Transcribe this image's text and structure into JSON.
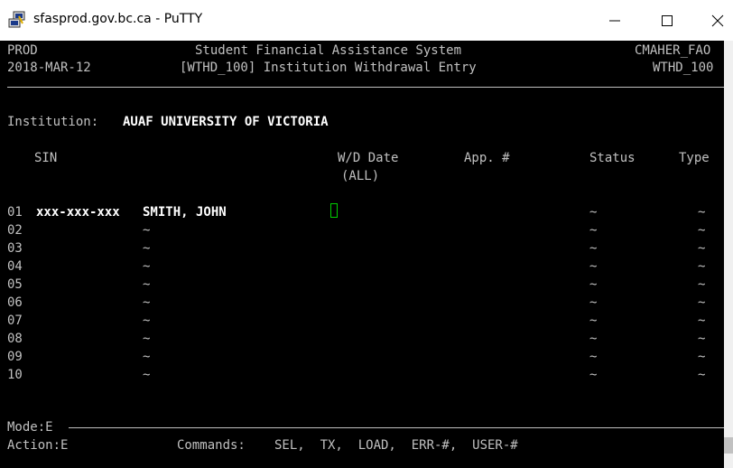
{
  "window": {
    "title": "sfasprod.gov.bc.ca - PuTTY"
  },
  "header": {
    "env": "PROD",
    "system_title": "Student Financial Assistance System",
    "user": "CMAHER_FAO",
    "date": "2018-MAR-12",
    "screen_title": "[WTHD_100] Institution Withdrawal Entry",
    "screen_code": "WTHD_100"
  },
  "institution": {
    "label": "Institution:",
    "value": "AUAF UNIVERSITY OF VICTORIA"
  },
  "columns": {
    "sin": "SIN",
    "wd_date": "W/D Date",
    "wd_date_sub": "(ALL)",
    "app": "App. #",
    "status": "Status",
    "type": "Type"
  },
  "rows": [
    {
      "num": "01",
      "sin": "xxx-xxx-xxx",
      "name": "SMITH, JOHN",
      "status": "~",
      "type": "~"
    },
    {
      "num": "02",
      "name": "~",
      "status": "~",
      "type": "~"
    },
    {
      "num": "03",
      "name": "~",
      "status": "~",
      "type": "~"
    },
    {
      "num": "04",
      "name": "~",
      "status": "~",
      "type": "~"
    },
    {
      "num": "05",
      "name": "~",
      "status": "~",
      "type": "~"
    },
    {
      "num": "06",
      "name": "~",
      "status": "~",
      "type": "~"
    },
    {
      "num": "07",
      "name": "~",
      "status": "~",
      "type": "~"
    },
    {
      "num": "08",
      "name": "~",
      "status": "~",
      "type": "~"
    },
    {
      "num": "09",
      "name": "~",
      "status": "~",
      "type": "~"
    },
    {
      "num": "10",
      "name": "~",
      "status": "~",
      "type": "~"
    }
  ],
  "footer": {
    "mode": "Mode:E",
    "action": "Action:E",
    "commands_label": "Commands:",
    "commands": "SEL,  TX,  LOAD,  ERR-#,  USER-#"
  },
  "icons": {
    "app": "putty-icon",
    "minimize": "minimize-icon",
    "maximize": "maximize-icon",
    "close": "close-icon"
  },
  "colors": {
    "terminal_bg": "#000000",
    "terminal_text": "#c0c0c0",
    "bold_text": "#ffffff",
    "cursor": "#00d000"
  }
}
